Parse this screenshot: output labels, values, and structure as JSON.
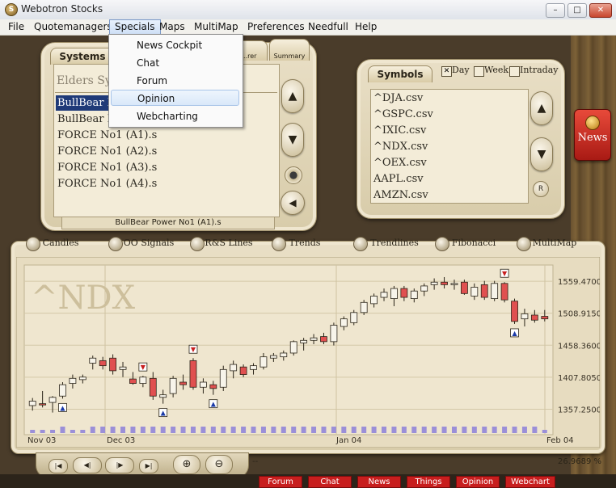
{
  "window": {
    "title": "Webotron Stocks",
    "app_icon_glyph": "S",
    "minimize_glyph": "–",
    "maximize_glyph": "□",
    "close_glyph": "✕"
  },
  "menubar": {
    "items": [
      "File",
      "Quotemanagers",
      "Specials",
      "Maps",
      "MultiMap",
      "Preferences",
      "Needfull",
      "Help"
    ],
    "active": "Specials"
  },
  "specials_menu": {
    "items": [
      "News Cockpit",
      "Chat",
      "Forum",
      "Opinion",
      "Webcharting"
    ],
    "highlighted": "Opinion"
  },
  "systems_panel": {
    "tabs": [
      "Systems",
      "...rer",
      "Summary"
    ],
    "filter_text": "Elders Sy",
    "items": [
      "BullBear P",
      "BullBear P",
      "FORCE No1 (A1).s",
      "FORCE No1 (A2).s",
      "FORCE No1 (A3).s",
      "FORCE No1 (A4).s"
    ],
    "selected_index": 0,
    "status_text": "BullBear Power No1 (A1).s",
    "up_glyph": "▲",
    "down_glyph": "▼",
    "left_glyph": "◀"
  },
  "symbols_panel": {
    "tab": "Symbols",
    "period_options": [
      {
        "label": "Day",
        "checked": true
      },
      {
        "label": "Week",
        "checked": false
      },
      {
        "label": "Intraday",
        "checked": false
      }
    ],
    "items": [
      "^DJA.csv",
      "^GSPC.csv",
      "^IXIC.csv",
      "^NDX.csv",
      "^OEX.csv",
      "AAPL.csv",
      "AMZN.csv"
    ],
    "r_button": "R",
    "up_glyph": "▲",
    "down_glyph": "▼"
  },
  "news_button": {
    "label": "News"
  },
  "chart_tabs": [
    "Candles",
    "OO Signals",
    "R&S Lines",
    "Trends",
    "Trendlines",
    "Fibonacci",
    "MultiMap"
  ],
  "nav_buttons": [
    "|◀",
    "◀|",
    "|▶",
    "▶|",
    "⊕",
    "⊖"
  ],
  "status": {
    "left_text": "--",
    "right_text": "26.9689 %",
    "tabs": [
      "Forum",
      "Chat",
      "News",
      "Things",
      "Opinion",
      "Webchart"
    ]
  },
  "colors": {
    "bull": "#f7f4ea",
    "bear": "#e05050",
    "volume": "#9b8fd8",
    "news_red": "#c81e1e"
  },
  "chart_data": {
    "type": "candlestick",
    "watermark": "^NDX",
    "y_ticks": [
      "1559.4700",
      "1508.9150",
      "1458.3600",
      "1407.8050",
      "1357.2500"
    ],
    "x_labels": [
      "Nov 03",
      "Dec 03",
      "Jan 04",
      "Feb 04"
    ],
    "ylim": [
      1340,
      1580
    ],
    "candles": [
      {
        "o": 1363,
        "h": 1375,
        "l": 1355,
        "c": 1370
      },
      {
        "o": 1366,
        "h": 1386,
        "l": 1360,
        "c": 1364
      },
      {
        "o": 1368,
        "h": 1378,
        "l": 1352,
        "c": 1376
      },
      {
        "o": 1378,
        "h": 1400,
        "l": 1374,
        "c": 1396
      },
      {
        "o": 1398,
        "h": 1412,
        "l": 1390,
        "c": 1406
      },
      {
        "o": 1404,
        "h": 1412,
        "l": 1398,
        "c": 1408
      },
      {
        "o": 1430,
        "h": 1442,
        "l": 1420,
        "c": 1438
      },
      {
        "o": 1434,
        "h": 1440,
        "l": 1420,
        "c": 1426
      },
      {
        "o": 1438,
        "h": 1444,
        "l": 1412,
        "c": 1418
      },
      {
        "o": 1420,
        "h": 1432,
        "l": 1408,
        "c": 1424
      },
      {
        "o": 1405,
        "h": 1416,
        "l": 1396,
        "c": 1398
      },
      {
        "o": 1398,
        "h": 1410,
        "l": 1392,
        "c": 1408
      },
      {
        "o": 1406,
        "h": 1416,
        "l": 1372,
        "c": 1378
      },
      {
        "o": 1376,
        "h": 1388,
        "l": 1366,
        "c": 1380
      },
      {
        "o": 1382,
        "h": 1410,
        "l": 1376,
        "c": 1406
      },
      {
        "o": 1400,
        "h": 1412,
        "l": 1388,
        "c": 1396
      },
      {
        "o": 1434,
        "h": 1438,
        "l": 1388,
        "c": 1392
      },
      {
        "o": 1392,
        "h": 1406,
        "l": 1382,
        "c": 1400
      },
      {
        "o": 1396,
        "h": 1402,
        "l": 1380,
        "c": 1390
      },
      {
        "o": 1392,
        "h": 1426,
        "l": 1386,
        "c": 1420
      },
      {
        "o": 1418,
        "h": 1434,
        "l": 1406,
        "c": 1428
      },
      {
        "o": 1424,
        "h": 1428,
        "l": 1408,
        "c": 1412
      },
      {
        "o": 1420,
        "h": 1430,
        "l": 1412,
        "c": 1426
      },
      {
        "o": 1424,
        "h": 1446,
        "l": 1420,
        "c": 1440
      },
      {
        "o": 1438,
        "h": 1446,
        "l": 1432,
        "c": 1442
      },
      {
        "o": 1440,
        "h": 1450,
        "l": 1434,
        "c": 1446
      },
      {
        "o": 1446,
        "h": 1466,
        "l": 1442,
        "c": 1464
      },
      {
        "o": 1462,
        "h": 1470,
        "l": 1450,
        "c": 1466
      },
      {
        "o": 1466,
        "h": 1476,
        "l": 1460,
        "c": 1470
      },
      {
        "o": 1472,
        "h": 1478,
        "l": 1460,
        "c": 1464
      },
      {
        "o": 1464,
        "h": 1494,
        "l": 1458,
        "c": 1490
      },
      {
        "o": 1488,
        "h": 1504,
        "l": 1482,
        "c": 1500
      },
      {
        "o": 1494,
        "h": 1514,
        "l": 1490,
        "c": 1510
      },
      {
        "o": 1510,
        "h": 1530,
        "l": 1506,
        "c": 1526
      },
      {
        "o": 1524,
        "h": 1540,
        "l": 1518,
        "c": 1536
      },
      {
        "o": 1534,
        "h": 1548,
        "l": 1528,
        "c": 1542
      },
      {
        "o": 1532,
        "h": 1552,
        "l": 1520,
        "c": 1548
      },
      {
        "o": 1548,
        "h": 1552,
        "l": 1528,
        "c": 1534
      },
      {
        "o": 1532,
        "h": 1548,
        "l": 1526,
        "c": 1544
      },
      {
        "o": 1544,
        "h": 1556,
        "l": 1536,
        "c": 1552
      },
      {
        "o": 1554,
        "h": 1564,
        "l": 1546,
        "c": 1558
      },
      {
        "o": 1558,
        "h": 1566,
        "l": 1548,
        "c": 1554
      },
      {
        "o": 1554,
        "h": 1562,
        "l": 1546,
        "c": 1556
      },
      {
        "o": 1558,
        "h": 1562,
        "l": 1538,
        "c": 1540
      },
      {
        "o": 1536,
        "h": 1556,
        "l": 1530,
        "c": 1550
      },
      {
        "o": 1554,
        "h": 1560,
        "l": 1530,
        "c": 1534
      },
      {
        "o": 1532,
        "h": 1560,
        "l": 1528,
        "c": 1556
      },
      {
        "o": 1556,
        "h": 1558,
        "l": 1526,
        "c": 1530
      },
      {
        "o": 1528,
        "h": 1532,
        "l": 1492,
        "c": 1496
      },
      {
        "o": 1500,
        "h": 1516,
        "l": 1488,
        "c": 1508
      },
      {
        "o": 1506,
        "h": 1514,
        "l": 1494,
        "c": 1498
      },
      {
        "o": 1504,
        "h": 1514,
        "l": 1496,
        "c": 1500
      }
    ],
    "volume": [
      1,
      1,
      1,
      2,
      1,
      1,
      2,
      2,
      2,
      2,
      2,
      2,
      2,
      2,
      2,
      2,
      2,
      2,
      2,
      2,
      2,
      2,
      2,
      2,
      2,
      2,
      2,
      2,
      2,
      2,
      2,
      2,
      2,
      2,
      2,
      2,
      2,
      2,
      2,
      2,
      2,
      2,
      2,
      2,
      2,
      2,
      2,
      2,
      2,
      2,
      2,
      1
    ],
    "signals": [
      {
        "index": 3,
        "type": "buy"
      },
      {
        "index": 11,
        "type": "sell"
      },
      {
        "index": 13,
        "type": "buy"
      },
      {
        "index": 16,
        "type": "sell"
      },
      {
        "index": 18,
        "type": "buy"
      },
      {
        "index": 47,
        "type": "sell"
      },
      {
        "index": 48,
        "type": "buy"
      }
    ]
  }
}
